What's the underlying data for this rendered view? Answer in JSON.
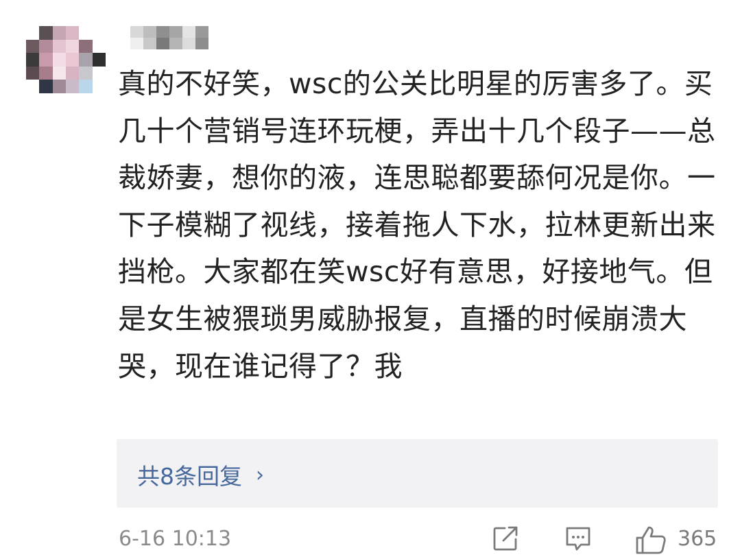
{
  "comment": {
    "text": "真的不好笑，wsc的公关比明星的厉害多了。买几十个营销号连环玩梗，弄出十几个段子——总裁娇妻，想你的液，连思聪都要舔何况是你。一下子模糊了视线，接着拖人下水，拉林更新出来挡枪。大家都在笑wsc好有意思，好接地气。但是女生被猥琐男威胁报复，直播的时候崩溃大哭，现在谁记得了？我"
  },
  "replies": {
    "label": "共8条回复",
    "chevron": "›"
  },
  "footer": {
    "timestamp": "6-16 10:13",
    "like_count": "365",
    "icons": [
      "share-icon",
      "comment-icon",
      "like-icon"
    ]
  },
  "colors": {
    "link": "#46689b",
    "reply_bg": "#f2f2f4",
    "meta_text": "#8a8a8a"
  }
}
